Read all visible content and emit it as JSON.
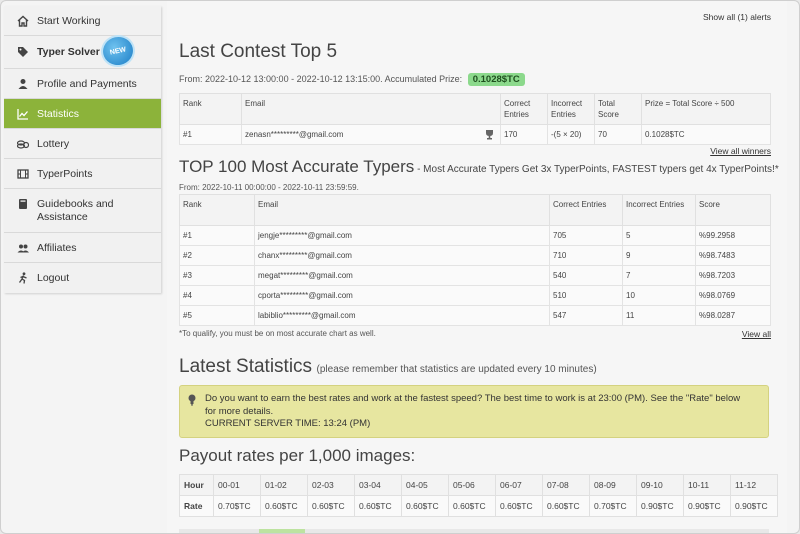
{
  "sidebar": {
    "items": [
      {
        "label": "Start Working",
        "icon": "home-icon"
      },
      {
        "label": "Typer Solver",
        "icon": "tag-icon",
        "badge": "NEW"
      },
      {
        "label": "Profile and Payments",
        "icon": "user-icon"
      },
      {
        "label": "Statistics",
        "icon": "chart-icon"
      },
      {
        "label": "Lottery",
        "icon": "coins-icon"
      },
      {
        "label": "TyperPoints",
        "icon": "film-icon"
      },
      {
        "label": "Guidebooks and Assistance",
        "icon": "book-icon"
      },
      {
        "label": "Affiliates",
        "icon": "users-icon"
      },
      {
        "label": "Logout",
        "icon": "run-icon"
      }
    ]
  },
  "header": {
    "alerts": "Show all (1) alerts"
  },
  "contest": {
    "title": "Last Contest Top 5",
    "period": "From: 2022-10-12 13:00:00 - 2022-10-12 13:15:00. Accumulated Prize:",
    "prize": "0.1028$TC",
    "headers": [
      "Rank",
      "Email",
      "Correct Entries",
      "Incorrect Entries",
      "Total Score",
      "Prize = Total Score ÷ 500"
    ],
    "rows": [
      [
        "#1",
        "zenasn*********@gmail.com",
        "170",
        "-(5 × 20)",
        "70",
        "0.1028$TC"
      ]
    ],
    "view_winners": "View all winners"
  },
  "accurate": {
    "title": "TOP 100 Most Accurate Typers",
    "subtitle": " - Most Accurate Typers Get 3x TyperPoints, FASTEST typers get 4x TyperPoints!*",
    "period": "From: 2022-10-11 00:00:00 - 2022-10-11 23:59:59.",
    "headers": [
      "Rank",
      "Email",
      "Correct Entries",
      "Incorrect Entries",
      "Score"
    ],
    "rows": [
      [
        "#1",
        "jengje*********@gmail.com",
        "705",
        "5",
        "%99.2958"
      ],
      [
        "#2",
        "chanx*********@gmail.com",
        "710",
        "9",
        "%98.7483"
      ],
      [
        "#3",
        "megat*********@gmail.com",
        "540",
        "7",
        "%98.7203"
      ],
      [
        "#4",
        "cporta*********@gmail.com",
        "510",
        "10",
        "%98.0769"
      ],
      [
        "#5",
        "labiblio*********@gmail.com",
        "547",
        "11",
        "%98.0287"
      ]
    ],
    "note": "*To qualify, you must be on most accurate chart as well.",
    "view_all": "View all"
  },
  "latest": {
    "title": "Latest Statistics",
    "subtitle": "(please remember that statistics are updated every 10 minutes)",
    "info_line1": "Do you want to earn the best rates and work at the fastest speed? The best time to work is at 23:00 (PM). See the \"Rate\" below",
    "info_line2": "for more details.",
    "info_line3": "CURRENT SERVER TIME: 13:24 (PM)"
  },
  "payout": {
    "title": "Payout rates per 1,000 images:",
    "hour_label": "Hour",
    "rate_label": "Rate",
    "hours": [
      "00-01",
      "01-02",
      "02-03",
      "03-04",
      "04-05",
      "05-06",
      "06-07",
      "07-08",
      "08-09",
      "09-10",
      "10-11",
      "11-12"
    ],
    "rates": [
      "0.70$TC",
      "0.60$TC",
      "0.60$TC",
      "0.60$TC",
      "0.60$TC",
      "0.60$TC",
      "0.60$TC",
      "0.60$TC",
      "0.70$TC",
      "0.90$TC",
      "0.90$TC",
      "0.90$TC"
    ]
  },
  "colors": {
    "accent": "#8cb33a",
    "prize": "#8cd98c",
    "info": "#e7e6a0"
  }
}
